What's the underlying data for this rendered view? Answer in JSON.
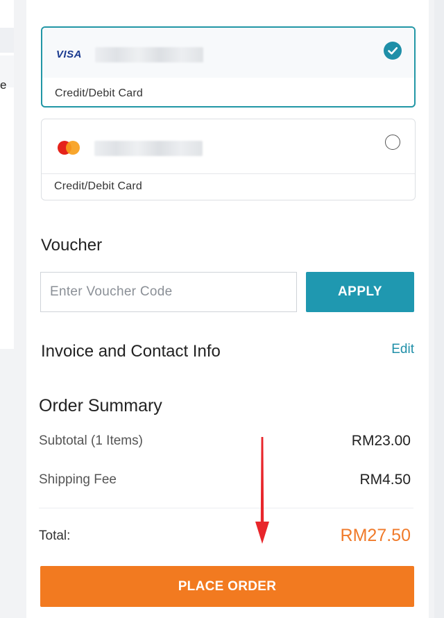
{
  "left_panel": {
    "peek_text": "e"
  },
  "payment_methods": [
    {
      "brand_icon": "visa-logo",
      "brand_text": "VISA",
      "label": "Credit/Debit Card",
      "selected": true,
      "card_number_masked": true
    },
    {
      "brand_icon": "mastercard-logo",
      "label": "Credit/Debit Card",
      "selected": false,
      "card_number_masked": true
    }
  ],
  "voucher": {
    "title": "Voucher",
    "placeholder": "Enter Voucher Code",
    "value": "",
    "apply_label": "APPLY"
  },
  "invoice": {
    "title": "Invoice and Contact Info",
    "edit_label": "Edit"
  },
  "order_summary": {
    "title": "Order Summary",
    "subtotal_label": "Subtotal (1 Items)",
    "subtotal_value": "RM23.00",
    "shipping_label": "Shipping Fee",
    "shipping_value": "RM4.50",
    "total_label": "Total:",
    "total_value": "RM27.50"
  },
  "place_order_label": "PLACE ORDER",
  "annotation": {
    "icon": "red-arrow-down"
  },
  "colors": {
    "accent_teal": "#2196a5",
    "apply_button": "#1f98b0",
    "order_button": "#f27a20",
    "total_price": "#f07a2a",
    "visa_blue": "#1a3a8f",
    "annotation_red": "#e8262b"
  }
}
